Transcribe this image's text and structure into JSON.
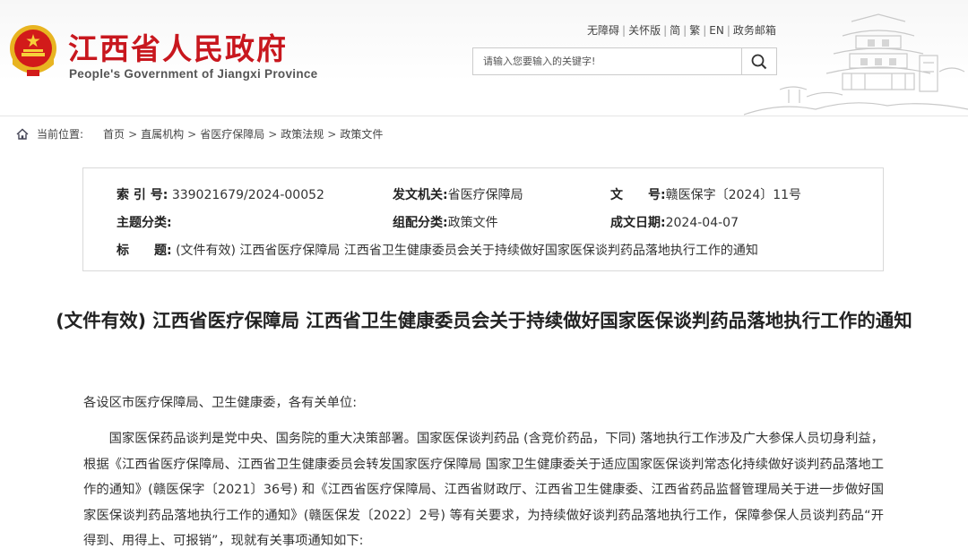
{
  "header": {
    "title": "江西省人民政府",
    "subtitle": "People's Government of Jiangxi Province",
    "top_links": [
      "无障碍",
      "关怀版",
      "简",
      "繁",
      "EN",
      "政务邮箱"
    ],
    "search_placeholder": "请输入您要输入的关键字!",
    "colors": {
      "brand_red": "#c8171e"
    }
  },
  "breadcrumb": {
    "current_label": "当前位置:",
    "items": [
      "首页",
      "直属机构",
      "省医疗保障局",
      "政策法规",
      "政策文件"
    ],
    "separator": ">"
  },
  "meta": {
    "index_label": "索 引 号:",
    "index_value": "339021679/2024-00052",
    "issuer_label": "发文机关:",
    "issuer_value": "省医疗保障局",
    "docno_label": "文　　号:",
    "docno_value": "赣医保字〔2024〕11号",
    "topic_label": "主题分类:",
    "topic_value": "",
    "category_label": "组配分类:",
    "category_value": "政策文件",
    "date_label": "成文日期:",
    "date_value": "2024-04-07",
    "title_label": "标　　题:",
    "title_value": "(文件有效) 江西省医疗保障局 江西省卫生健康委员会关于持续做好国家医保谈判药品落地执行工作的通知"
  },
  "article": {
    "title": "(文件有效) 江西省医疗保障局 江西省卫生健康委员会关于持续做好国家医保谈判药品落地执行工作的通知",
    "greeting": "各设区市医疗保障局、卫生健康委，各有关单位:",
    "paragraph1": "国家医保药品谈判是党中央、国务院的重大决策部署。国家医保谈判药品 (含竞价药品，下同) 落地执行工作涉及广大参保人员切身利益，根据《江西省医疗保障局、江西省卫生健康委员会转发国家医疗保障局 国家卫生健康委关于适应国家医保谈判常态化持续做好谈判药品落地工作的通知》(赣医保字〔2021〕36号) 和《江西省医疗保障局、江西省财政厅、江西省卫生健康委、江西省药品监督管理局关于进一步做好国家医保谈判药品落地执行工作的通知》(赣医保发〔2022〕2号) 等有关要求，为持续做好谈判药品落地执行工作，保障参保人员谈判药品“开得到、用得上、可报销”，现就有关事项通知如下:"
  }
}
